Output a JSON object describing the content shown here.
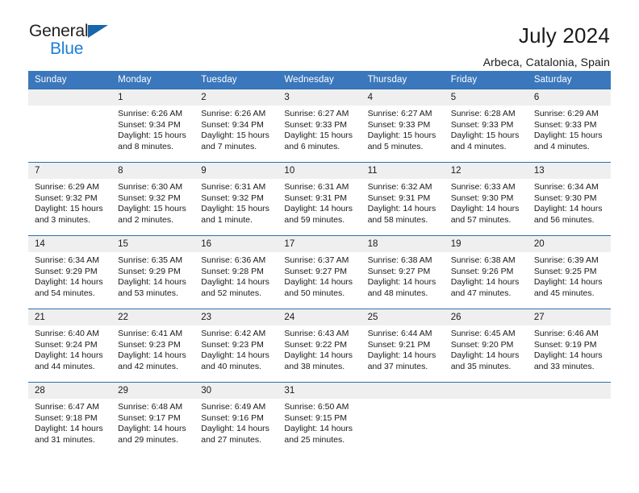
{
  "brand": {
    "name_part1": "General",
    "name_part2": "Blue",
    "triangle_color": "#1866ab",
    "blue_color": "#1c7fd4"
  },
  "header": {
    "title": "July 2024",
    "subtitle": "Arbeca, Catalonia, Spain",
    "accent_color": "#3b77bc"
  },
  "calendar": {
    "day_headers": [
      "Sunday",
      "Monday",
      "Tuesday",
      "Wednesday",
      "Thursday",
      "Friday",
      "Saturday"
    ],
    "weeks": [
      [
        {
          "day": "",
          "sunrise": "",
          "sunset": "",
          "daylight": ""
        },
        {
          "day": "1",
          "sunrise": "Sunrise: 6:26 AM",
          "sunset": "Sunset: 9:34 PM",
          "daylight": "Daylight: 15 hours and 8 minutes."
        },
        {
          "day": "2",
          "sunrise": "Sunrise: 6:26 AM",
          "sunset": "Sunset: 9:34 PM",
          "daylight": "Daylight: 15 hours and 7 minutes."
        },
        {
          "day": "3",
          "sunrise": "Sunrise: 6:27 AM",
          "sunset": "Sunset: 9:33 PM",
          "daylight": "Daylight: 15 hours and 6 minutes."
        },
        {
          "day": "4",
          "sunrise": "Sunrise: 6:27 AM",
          "sunset": "Sunset: 9:33 PM",
          "daylight": "Daylight: 15 hours and 5 minutes."
        },
        {
          "day": "5",
          "sunrise": "Sunrise: 6:28 AM",
          "sunset": "Sunset: 9:33 PM",
          "daylight": "Daylight: 15 hours and 4 minutes."
        },
        {
          "day": "6",
          "sunrise": "Sunrise: 6:29 AM",
          "sunset": "Sunset: 9:33 PM",
          "daylight": "Daylight: 15 hours and 4 minutes."
        }
      ],
      [
        {
          "day": "7",
          "sunrise": "Sunrise: 6:29 AM",
          "sunset": "Sunset: 9:32 PM",
          "daylight": "Daylight: 15 hours and 3 minutes."
        },
        {
          "day": "8",
          "sunrise": "Sunrise: 6:30 AM",
          "sunset": "Sunset: 9:32 PM",
          "daylight": "Daylight: 15 hours and 2 minutes."
        },
        {
          "day": "9",
          "sunrise": "Sunrise: 6:31 AM",
          "sunset": "Sunset: 9:32 PM",
          "daylight": "Daylight: 15 hours and 1 minute."
        },
        {
          "day": "10",
          "sunrise": "Sunrise: 6:31 AM",
          "sunset": "Sunset: 9:31 PM",
          "daylight": "Daylight: 14 hours and 59 minutes."
        },
        {
          "day": "11",
          "sunrise": "Sunrise: 6:32 AM",
          "sunset": "Sunset: 9:31 PM",
          "daylight": "Daylight: 14 hours and 58 minutes."
        },
        {
          "day": "12",
          "sunrise": "Sunrise: 6:33 AM",
          "sunset": "Sunset: 9:30 PM",
          "daylight": "Daylight: 14 hours and 57 minutes."
        },
        {
          "day": "13",
          "sunrise": "Sunrise: 6:34 AM",
          "sunset": "Sunset: 9:30 PM",
          "daylight": "Daylight: 14 hours and 56 minutes."
        }
      ],
      [
        {
          "day": "14",
          "sunrise": "Sunrise: 6:34 AM",
          "sunset": "Sunset: 9:29 PM",
          "daylight": "Daylight: 14 hours and 54 minutes."
        },
        {
          "day": "15",
          "sunrise": "Sunrise: 6:35 AM",
          "sunset": "Sunset: 9:29 PM",
          "daylight": "Daylight: 14 hours and 53 minutes."
        },
        {
          "day": "16",
          "sunrise": "Sunrise: 6:36 AM",
          "sunset": "Sunset: 9:28 PM",
          "daylight": "Daylight: 14 hours and 52 minutes."
        },
        {
          "day": "17",
          "sunrise": "Sunrise: 6:37 AM",
          "sunset": "Sunset: 9:27 PM",
          "daylight": "Daylight: 14 hours and 50 minutes."
        },
        {
          "day": "18",
          "sunrise": "Sunrise: 6:38 AM",
          "sunset": "Sunset: 9:27 PM",
          "daylight": "Daylight: 14 hours and 48 minutes."
        },
        {
          "day": "19",
          "sunrise": "Sunrise: 6:38 AM",
          "sunset": "Sunset: 9:26 PM",
          "daylight": "Daylight: 14 hours and 47 minutes."
        },
        {
          "day": "20",
          "sunrise": "Sunrise: 6:39 AM",
          "sunset": "Sunset: 9:25 PM",
          "daylight": "Daylight: 14 hours and 45 minutes."
        }
      ],
      [
        {
          "day": "21",
          "sunrise": "Sunrise: 6:40 AM",
          "sunset": "Sunset: 9:24 PM",
          "daylight": "Daylight: 14 hours and 44 minutes."
        },
        {
          "day": "22",
          "sunrise": "Sunrise: 6:41 AM",
          "sunset": "Sunset: 9:23 PM",
          "daylight": "Daylight: 14 hours and 42 minutes."
        },
        {
          "day": "23",
          "sunrise": "Sunrise: 6:42 AM",
          "sunset": "Sunset: 9:23 PM",
          "daylight": "Daylight: 14 hours and 40 minutes."
        },
        {
          "day": "24",
          "sunrise": "Sunrise: 6:43 AM",
          "sunset": "Sunset: 9:22 PM",
          "daylight": "Daylight: 14 hours and 38 minutes."
        },
        {
          "day": "25",
          "sunrise": "Sunrise: 6:44 AM",
          "sunset": "Sunset: 9:21 PM",
          "daylight": "Daylight: 14 hours and 37 minutes."
        },
        {
          "day": "26",
          "sunrise": "Sunrise: 6:45 AM",
          "sunset": "Sunset: 9:20 PM",
          "daylight": "Daylight: 14 hours and 35 minutes."
        },
        {
          "day": "27",
          "sunrise": "Sunrise: 6:46 AM",
          "sunset": "Sunset: 9:19 PM",
          "daylight": "Daylight: 14 hours and 33 minutes."
        }
      ],
      [
        {
          "day": "28",
          "sunrise": "Sunrise: 6:47 AM",
          "sunset": "Sunset: 9:18 PM",
          "daylight": "Daylight: 14 hours and 31 minutes."
        },
        {
          "day": "29",
          "sunrise": "Sunrise: 6:48 AM",
          "sunset": "Sunset: 9:17 PM",
          "daylight": "Daylight: 14 hours and 29 minutes."
        },
        {
          "day": "30",
          "sunrise": "Sunrise: 6:49 AM",
          "sunset": "Sunset: 9:16 PM",
          "daylight": "Daylight: 14 hours and 27 minutes."
        },
        {
          "day": "31",
          "sunrise": "Sunrise: 6:50 AM",
          "sunset": "Sunset: 9:15 PM",
          "daylight": "Daylight: 14 hours and 25 minutes."
        },
        {
          "day": "",
          "sunrise": "",
          "sunset": "",
          "daylight": ""
        },
        {
          "day": "",
          "sunrise": "",
          "sunset": "",
          "daylight": ""
        },
        {
          "day": "",
          "sunrise": "",
          "sunset": "",
          "daylight": ""
        }
      ]
    ]
  }
}
